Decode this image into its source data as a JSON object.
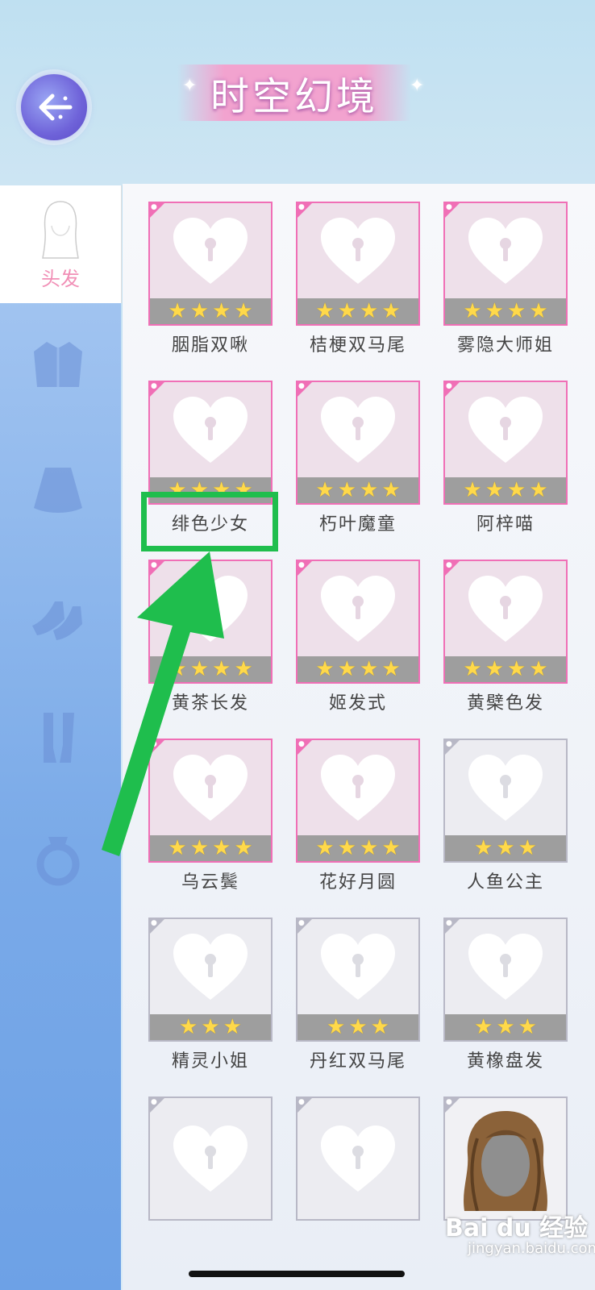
{
  "header": {
    "title": "时空幻境",
    "back_icon": "back-arrow-icon"
  },
  "sidebar": {
    "active_category": {
      "label": "头发",
      "icon": "hair-icon"
    },
    "categories": [
      {
        "icon": "jacket-icon"
      },
      {
        "icon": "skirt-icon"
      },
      {
        "icon": "shoes-icon"
      },
      {
        "icon": "socks-icon"
      },
      {
        "icon": "ring-icon"
      }
    ]
  },
  "items": [
    {
      "name": "胭脂双啾",
      "stars": 4,
      "tier": "pink"
    },
    {
      "name": "桔梗双马尾",
      "stars": 4,
      "tier": "pink"
    },
    {
      "name": "雾隐大师姐",
      "stars": 4,
      "tier": "pink"
    },
    {
      "name": "绯色少女",
      "stars": 4,
      "tier": "pink"
    },
    {
      "name": "朽叶魔童",
      "stars": 4,
      "tier": "pink"
    },
    {
      "name": "阿梓喵",
      "stars": 4,
      "tier": "pink"
    },
    {
      "name": "黄茶长发",
      "stars": 4,
      "tier": "pink"
    },
    {
      "name": "姬发式",
      "stars": 4,
      "tier": "pink"
    },
    {
      "name": "黄檗色发",
      "stars": 4,
      "tier": "pink"
    },
    {
      "name": "乌云鬓",
      "stars": 4,
      "tier": "pink"
    },
    {
      "name": "花好月圆",
      "stars": 4,
      "tier": "pink"
    },
    {
      "name": "人鱼公主",
      "stars": 3,
      "tier": "gray"
    },
    {
      "name": "精灵小姐",
      "stars": 3,
      "tier": "gray"
    },
    {
      "name": "丹红双马尾",
      "stars": 3,
      "tier": "gray"
    },
    {
      "name": "黄橡盘发",
      "stars": 3,
      "tier": "gray"
    },
    {
      "name": "",
      "stars": 0,
      "tier": "gray"
    },
    {
      "name": "",
      "stars": 0,
      "tier": "gray"
    },
    {
      "name": "",
      "stars": 0,
      "tier": "owned"
    }
  ],
  "watermark": {
    "text": "Bai du 经验",
    "sub": "jingyan.baidu.com"
  },
  "colors": {
    "accent_pink": "#f06fb6",
    "highlight_green": "#1fbe4d"
  }
}
